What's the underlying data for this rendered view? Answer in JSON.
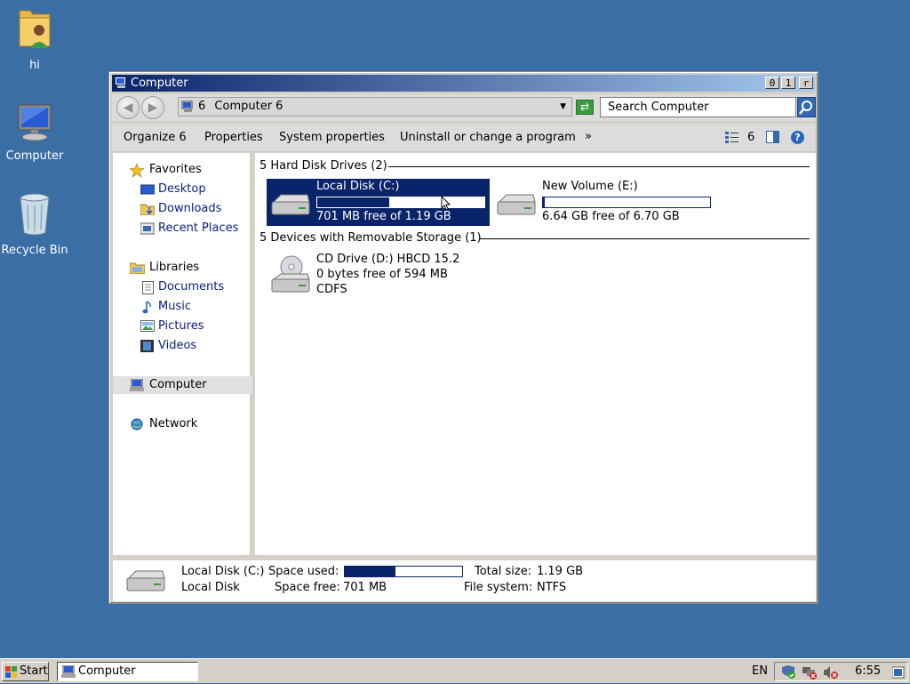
{
  "desktop": {
    "icons": [
      {
        "label": "hi"
      },
      {
        "label": "Computer"
      },
      {
        "label": "Recycle Bin"
      }
    ]
  },
  "window": {
    "title": "Computer",
    "title_buttons": [
      "0",
      "1",
      "r"
    ],
    "address": {
      "prefix": "6",
      "path": "Computer 6"
    },
    "search_placeholder": "Search Computer",
    "toolbar": {
      "organize": "Organize 6",
      "properties": "Properties",
      "system_properties": "System properties",
      "uninstall": "Uninstall or change a program",
      "more": "»",
      "views_label": "6"
    },
    "nav": {
      "favorites": "Favorites",
      "desktop": "Desktop",
      "downloads": "Downloads",
      "recent_places": "Recent Places",
      "libraries": "Libraries",
      "documents": "Documents",
      "music": "Music",
      "pictures": "Pictures",
      "videos": "Videos",
      "computer": "Computer",
      "network": "Network"
    },
    "groups": {
      "hard_disks": "5 Hard Disk Drives (2)",
      "removable": "5 Devices with Removable Storage (1)"
    },
    "drives": {
      "c": {
        "name": "Local Disk (C:)",
        "free_text": "701 MB free of 1.19 GB",
        "used_fraction": 0.43
      },
      "e": {
        "name": "New Volume (E:)",
        "free_text": "6.64 GB free of 6.70 GB",
        "used_fraction": 0.01
      },
      "d": {
        "name": "CD Drive (D:) HBCD 15.2",
        "free_text": "0 bytes free of 594 MB",
        "fs": "CDFS"
      }
    },
    "details": {
      "name": "Local Disk (C:)",
      "type": "Local Disk",
      "space_used_label": "Space used:",
      "space_used_fraction": 0.43,
      "space_free_label": "Space free:",
      "space_free_value": "701 MB",
      "total_size_label": "Total size:",
      "total_size_value": "1.19 GB",
      "fs_label": "File system:",
      "fs_value": "NTFS"
    }
  },
  "taskbar": {
    "start": "Start",
    "task": "Computer",
    "lang": "EN",
    "clock": "6:55"
  },
  "colors": {
    "desktop": "#3a6ea5",
    "selection": "#0a246a",
    "link": "#0a1e7c"
  }
}
